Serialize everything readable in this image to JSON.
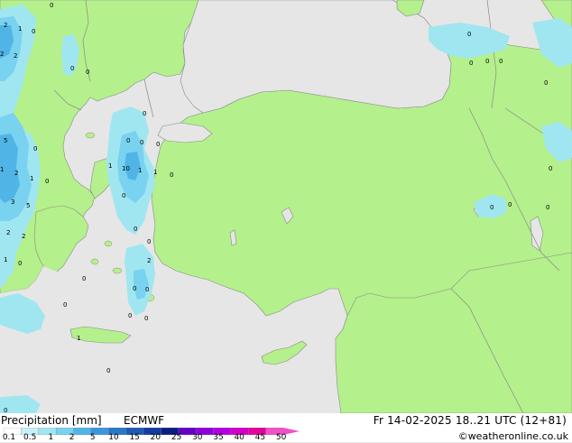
{
  "map": {
    "land_color": "#b4f08c",
    "sea_color": "#e6e6e6",
    "precip_light": "#a0e6f0",
    "precip_mid": "#78d2f0",
    "precip_dark": "#50b4e6"
  },
  "precip_values": [
    {
      "id": "p1",
      "text": "2"
    },
    {
      "id": "p2",
      "text": "1"
    },
    {
      "id": "p3",
      "text": "0"
    },
    {
      "id": "p4",
      "text": "2"
    },
    {
      "id": "p5",
      "text": "2"
    },
    {
      "id": "p6",
      "text": "0"
    },
    {
      "id": "p7",
      "text": "0"
    },
    {
      "id": "p8",
      "text": "0"
    },
    {
      "id": "p9",
      "text": "0"
    },
    {
      "id": "p10",
      "text": "0"
    },
    {
      "id": "p11",
      "text": "0"
    },
    {
      "id": "p12",
      "text": "5"
    },
    {
      "id": "p13",
      "text": "0"
    },
    {
      "id": "p14",
      "text": "1"
    },
    {
      "id": "p15",
      "text": "2"
    },
    {
      "id": "p16",
      "text": "1"
    },
    {
      "id": "p17",
      "text": "0"
    },
    {
      "id": "p18",
      "text": "3"
    },
    {
      "id": "p19",
      "text": "5"
    },
    {
      "id": "p20",
      "text": "2"
    },
    {
      "id": "p21",
      "text": "2"
    },
    {
      "id": "p22",
      "text": "1"
    },
    {
      "id": "p23",
      "text": "0"
    },
    {
      "id": "p24",
      "text": "0"
    },
    {
      "id": "p25",
      "text": "0"
    },
    {
      "id": "p26",
      "text": "0"
    },
    {
      "id": "p27",
      "text": "0"
    },
    {
      "id": "p28",
      "text": "1"
    },
    {
      "id": "p29",
      "text": "10"
    },
    {
      "id": "p30",
      "text": "1"
    },
    {
      "id": "p31",
      "text": "1"
    },
    {
      "id": "p32",
      "text": "0"
    },
    {
      "id": "p33",
      "text": "0"
    },
    {
      "id": "p34",
      "text": "0"
    },
    {
      "id": "p35",
      "text": "0"
    },
    {
      "id": "p36",
      "text": "2"
    },
    {
      "id": "p37",
      "text": "0"
    },
    {
      "id": "p38",
      "text": "0"
    },
    {
      "id": "p39",
      "text": "0"
    },
    {
      "id": "p40",
      "text": "0"
    },
    {
      "id": "p41",
      "text": "0"
    },
    {
      "id": "p42",
      "text": "0"
    },
    {
      "id": "p43",
      "text": "1"
    },
    {
      "id": "p44",
      "text": "0"
    },
    {
      "id": "p45",
      "text": "0"
    },
    {
      "id": "p46",
      "text": "0"
    },
    {
      "id": "p47",
      "text": "0"
    },
    {
      "id": "p48",
      "text": "0"
    },
    {
      "id": "p49",
      "text": "0"
    },
    {
      "id": "p50",
      "text": "0"
    },
    {
      "id": "p51",
      "text": "0"
    },
    {
      "id": "p52",
      "text": "0"
    },
    {
      "id": "p53",
      "text": "0"
    },
    {
      "id": "p54",
      "text": "1"
    },
    {
      "id": "p55",
      "text": "0"
    },
    {
      "id": "p56",
      "text": "1"
    },
    {
      "id": "p57",
      "text": "0"
    },
    {
      "id": "p58",
      "text": "0"
    },
    {
      "id": "p59",
      "text": "0"
    }
  ],
  "footer": {
    "title": "Precipitation [mm]",
    "model": "ECMWF",
    "date": "Fr 14-02-2025 18..21 UTC (12+81)",
    "credit": "©weatheronline.co.uk"
  },
  "colorbar": {
    "colors": [
      "#ffffff",
      "#c8f0fa",
      "#a0e6f0",
      "#78d2f0",
      "#50b4e6",
      "#3c96dc",
      "#2878c8",
      "#1e5ab4",
      "#143ca0",
      "#0a1e82",
      "#6400c8",
      "#8c00dc",
      "#b400e6",
      "#d200c8",
      "#e600a0",
      "#f050c8"
    ],
    "tick_labels": [
      "0.1",
      "0.5",
      "1",
      "2",
      "5",
      "10",
      "15",
      "20",
      "25",
      "30",
      "35",
      "40",
      "45",
      "50"
    ]
  }
}
